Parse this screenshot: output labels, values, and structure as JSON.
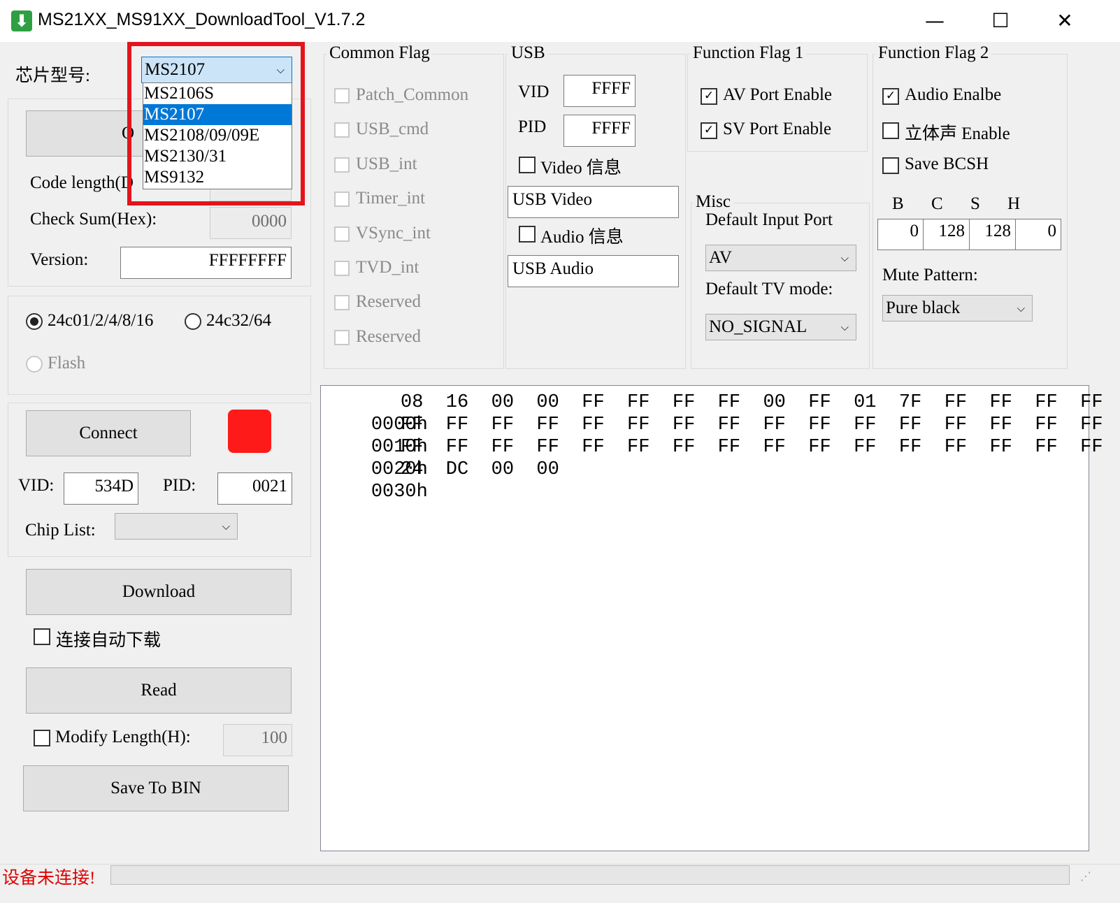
{
  "window": {
    "title": "MS21XX_MS91XX_DownloadTool_V1.7.2",
    "icon": "download-arrow-icon",
    "min_glyph": "—",
    "max_glyph": "☐",
    "close_glyph": "✕"
  },
  "chip": {
    "label": "芯片型号:",
    "selected": "MS2107",
    "options": [
      "MS2106S",
      "MS2107",
      "MS2108/09/09E",
      "MS2130/31",
      "MS9132"
    ],
    "selected_index": 1
  },
  "file": {
    "open_button_fragment": "O",
    "code_length_label_fragment": "Code length(D",
    "checksum_label": "Check Sum(Hex):",
    "checksum_value": "0000",
    "version_label": "Version:",
    "version_value": "FFFFFFFF"
  },
  "storage": {
    "opt1": "24c01/2/4/8/16",
    "opt2": "24c32/64",
    "opt3": "Flash",
    "selected": "24c01/2/4/8/16"
  },
  "connection": {
    "connect_label": "Connect",
    "status_color": "#ff1a1a",
    "vid_label": "VID:",
    "vid_value": "534D",
    "pid_label": "PID:",
    "pid_value": "0021",
    "chip_list_label": "Chip List:",
    "chip_list_value": ""
  },
  "actions": {
    "download_label": "Download",
    "auto_download_label": "连接自动下载",
    "read_label": "Read",
    "modify_label": "Modify  Length(H):",
    "modify_value": "100",
    "save_label": "Save To BIN"
  },
  "common_flag": {
    "title": "Common Flag",
    "items": [
      "Patch_Common",
      "USB_cmd",
      "USB_int",
      "Timer_int",
      "VSync_int",
      "TVD_int",
      "Reserved",
      "Reserved"
    ]
  },
  "usb": {
    "title": "USB",
    "vid_label": "VID",
    "vid_value": "FFFF",
    "pid_label": "PID",
    "pid_value": "FFFF",
    "video_label": "Video 信息",
    "video_name": "USB Video",
    "audio_label": "Audio 信息",
    "audio_name": "USB Audio"
  },
  "func1": {
    "title": "Function Flag 1",
    "av_label": "AV Port Enable",
    "sv_label": "SV Port Enable"
  },
  "misc": {
    "title": "Misc",
    "input_port_label": "Default Input Port",
    "input_port_value": "AV",
    "tv_mode_label": "Default TV mode:",
    "tv_mode_value": "NO_SIGNAL"
  },
  "func2": {
    "title": "Function Flag 2",
    "audio_label": "Audio Enalbe",
    "stereo_label": "立体声 Enable",
    "bcsh_label": "Save BCSH",
    "b_label": "B",
    "c_label": "C",
    "s_label": "S",
    "h_label": "H",
    "b_value": "0",
    "c_value": "128",
    "s_value": "128",
    "h_value": "0",
    "mute_label": "Mute Pattern:",
    "mute_value": "Pure black"
  },
  "hex": {
    "rows": [
      {
        "addr": "0000h",
        "bytes": "08  16  00  00  FF  FF  FF  FF  00  FF  01  7F  FF  FF  FF  FF"
      },
      {
        "addr": "0010h",
        "bytes": "FF  FF  FF  FF  FF  FF  FF  FF  FF  FF  FF  FF  FF  FF  FF  FF"
      },
      {
        "addr": "0020h",
        "bytes": "FF  FF  FF  FF  FF  FF  FF  FF  FF  FF  FF  FF  FF  FF  FF  FF"
      },
      {
        "addr": "0030h",
        "bytes": "24  DC  00  00"
      }
    ]
  },
  "status": {
    "text": "设备未连接!"
  }
}
